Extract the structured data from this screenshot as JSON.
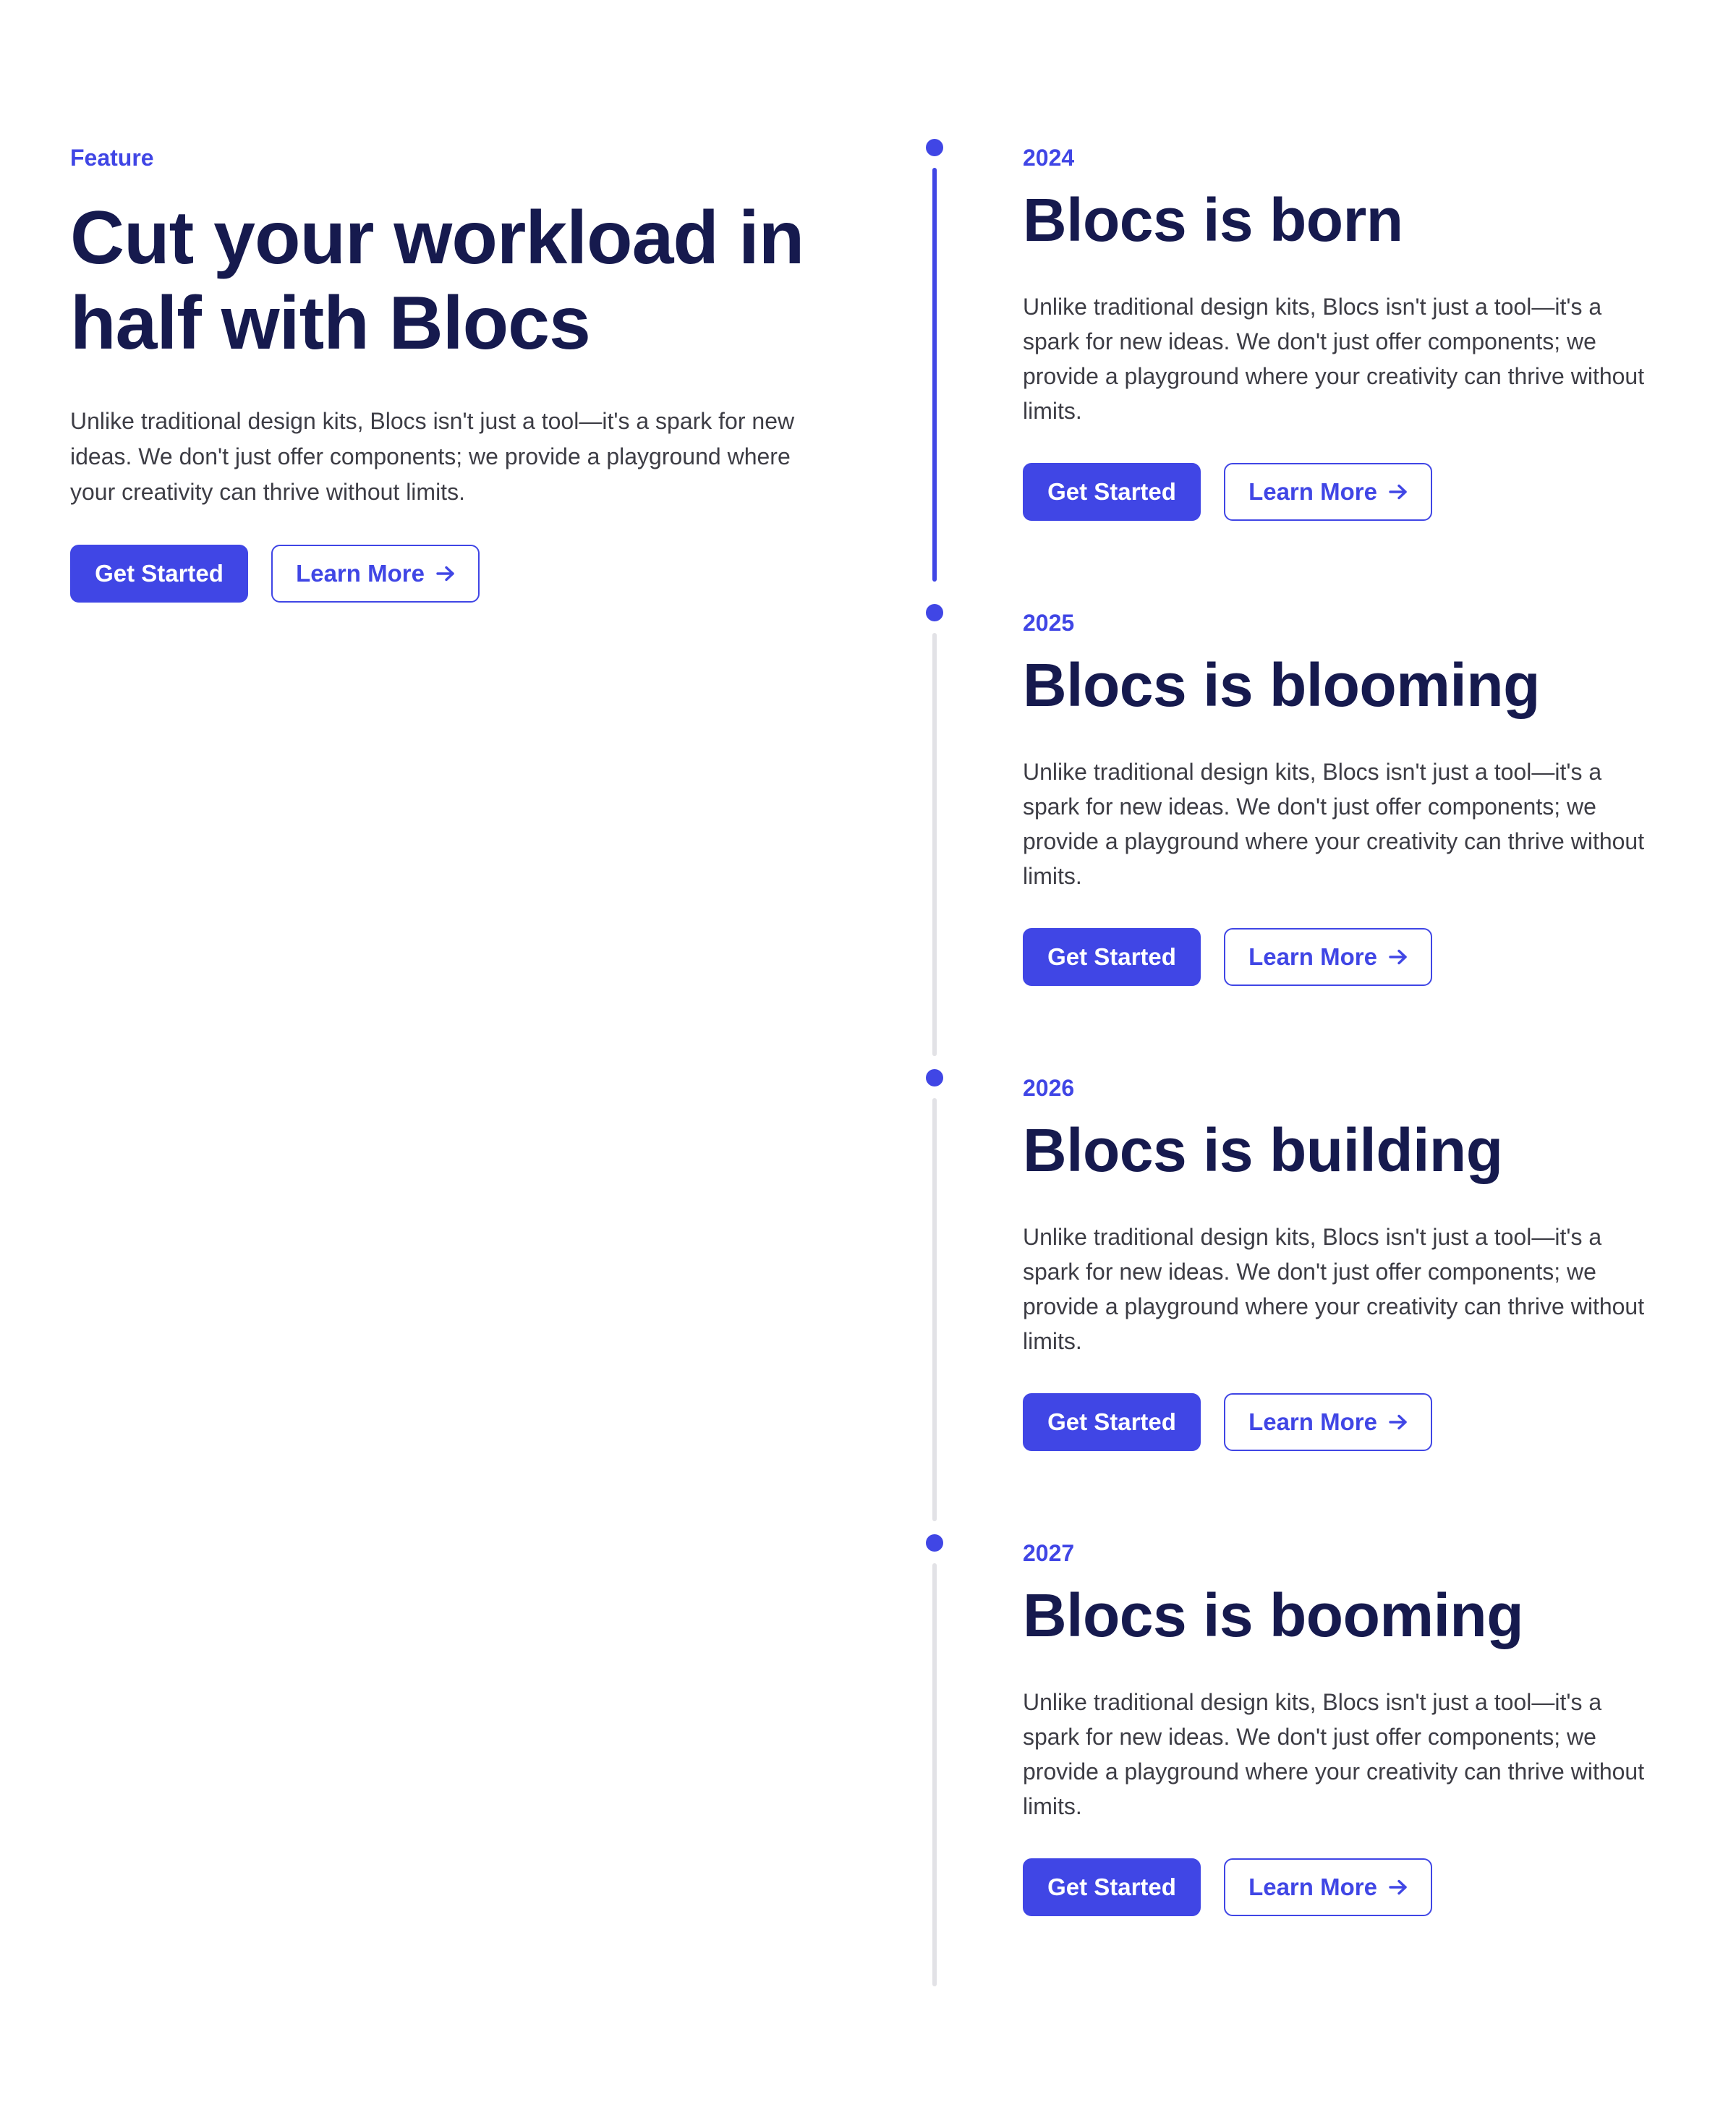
{
  "intro": {
    "eyebrow": "Feature",
    "title": "Cut your workload in half with Blocs",
    "description": "Unlike traditional design kits, Blocs isn't just a tool—it's a spark for new ideas. We don't just offer components; we provide a playground where your creativity can thrive without limits.",
    "primary_button": "Get Started",
    "secondary_button": "Learn More"
  },
  "timeline": {
    "items": [
      {
        "year": "2024",
        "title": "Blocs is born",
        "description": "Unlike traditional design kits, Blocs isn't just a tool—it's a spark for new ideas. We don't just offer components; we provide a playground where your creativity can thrive without limits.",
        "primary_button": "Get Started",
        "secondary_button": "Learn More",
        "active": true
      },
      {
        "year": "2025",
        "title": "Blocs is blooming",
        "description": "Unlike traditional design kits, Blocs isn't just a tool—it's a spark for new ideas. We don't just offer components; we provide a playground where your creativity can thrive without limits.",
        "primary_button": "Get Started",
        "secondary_button": "Learn More",
        "active": false
      },
      {
        "year": "2026",
        "title": "Blocs is building",
        "description": "Unlike traditional design kits, Blocs isn't just a tool—it's a spark for new ideas. We don't just offer components; we provide a playground where your creativity can thrive without limits.",
        "primary_button": "Get Started",
        "secondary_button": "Learn More",
        "active": false
      },
      {
        "year": "2027",
        "title": "Blocs is booming",
        "description": "Unlike traditional design kits, Blocs isn't just a tool—it's a spark for new ideas. We don't just offer components; we provide a playground where your creativity can thrive without limits.",
        "primary_button": "Get Started",
        "secondary_button": "Learn More",
        "active": false
      }
    ]
  },
  "icons": {
    "button_arrow": "arrow-right-icon"
  },
  "colors": {
    "accent": "#4046e5",
    "heading": "#161a4e",
    "body_text": "#3d3d45",
    "timeline_inactive": "#e2e2e6",
    "background": "#ffffff"
  }
}
